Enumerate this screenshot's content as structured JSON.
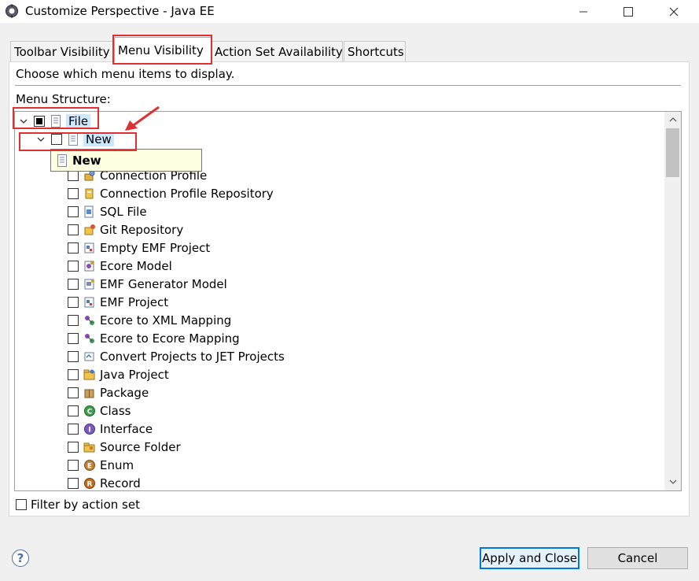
{
  "window": {
    "title": "Customize Perspective - Java EE",
    "icon": "eclipse-perspective-icon"
  },
  "tabs": [
    {
      "label": "Toolbar Visibility",
      "active": false
    },
    {
      "label": "Menu Visibility",
      "active": true
    },
    {
      "label": "Action Set Availability",
      "active": false
    },
    {
      "label": "Shortcuts",
      "active": false
    }
  ],
  "panel": {
    "instruction": "Choose which menu items to display.",
    "structure_label": "Menu Structure:"
  },
  "tree": {
    "root": {
      "label": "File",
      "state": "partial",
      "expanded": true
    },
    "submenu": {
      "label": "New",
      "state": "unchecked",
      "expanded": true
    },
    "items": [
      {
        "label": "Connection Profile",
        "icon": "connection-profile-icon"
      },
      {
        "label": "Connection Profile Repository",
        "icon": "profile-repository-icon"
      },
      {
        "label": "SQL File",
        "icon": "sql-file-icon"
      },
      {
        "label": "Git Repository",
        "icon": "git-repository-icon"
      },
      {
        "label": "Empty EMF Project",
        "icon": "emf-project-icon"
      },
      {
        "label": "Ecore Model",
        "icon": "ecore-model-icon"
      },
      {
        "label": "EMF Generator Model",
        "icon": "emf-generator-icon"
      },
      {
        "label": "EMF Project",
        "icon": "emf-project-icon"
      },
      {
        "label": "Ecore to XML Mapping",
        "icon": "mapping-icon"
      },
      {
        "label": "Ecore to Ecore Mapping",
        "icon": "mapping-icon"
      },
      {
        "label": "Convert Projects to JET Projects",
        "icon": "jet-convert-icon"
      },
      {
        "label": "Java Project",
        "icon": "java-project-icon"
      },
      {
        "label": "Package",
        "icon": "package-icon"
      },
      {
        "label": "Class",
        "icon": "class-icon"
      },
      {
        "label": "Interface",
        "icon": "interface-icon"
      },
      {
        "label": "Source Folder",
        "icon": "source-folder-icon"
      },
      {
        "label": "Enum",
        "icon": "enum-icon"
      },
      {
        "label": "Record",
        "icon": "record-icon"
      }
    ]
  },
  "tooltip": {
    "label": "New"
  },
  "filter": {
    "label": "Filter by action set",
    "checked": false
  },
  "buttons": {
    "apply": "Apply and Close",
    "cancel": "Cancel"
  },
  "colors": {
    "annotation_red": "#e03030",
    "accent": "#0078d7",
    "selection": "#cce8ff"
  }
}
